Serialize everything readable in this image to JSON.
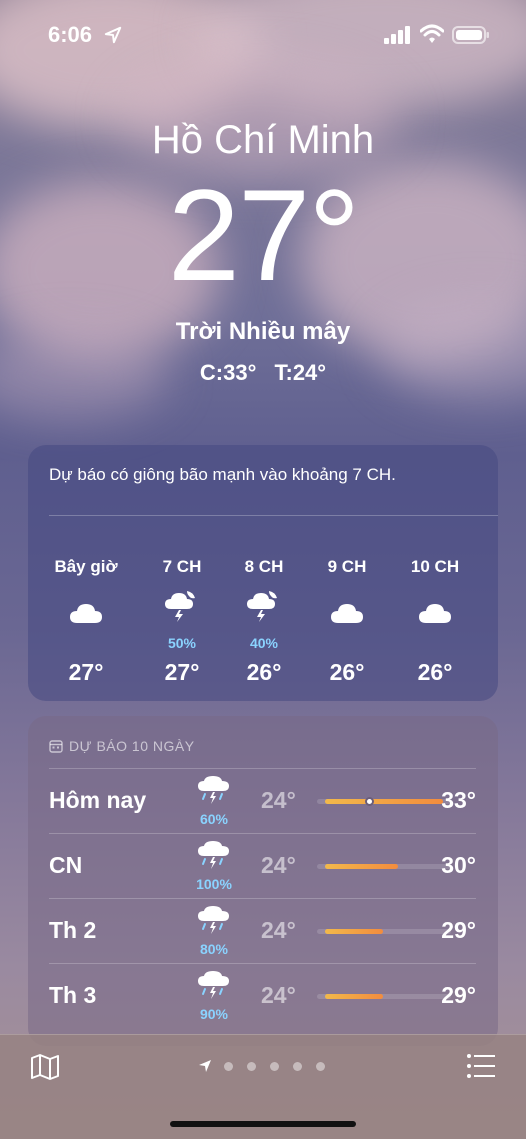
{
  "status_bar": {
    "time": "6:06"
  },
  "header": {
    "city": "Hồ Chí Minh",
    "temperature": "27°",
    "condition": "Trời Nhiều mây",
    "high": "C:33°",
    "low": "T:24°"
  },
  "hourly": {
    "alert": "Dự báo có giông bão mạnh vào khoảng 7 CH.",
    "items": [
      {
        "label": "Bây giờ",
        "icon": "cloud-icon",
        "precip": "",
        "temp": "27°"
      },
      {
        "label": "7 CH",
        "icon": "thunderstorm-moon-icon",
        "precip": "50%",
        "temp": "27°"
      },
      {
        "label": "8 CH",
        "icon": "thunderstorm-moon-icon",
        "precip": "40%",
        "temp": "26°"
      },
      {
        "label": "9 CH",
        "icon": "cloud-icon",
        "precip": "",
        "temp": "26°"
      },
      {
        "label": "10 CH",
        "icon": "cloud-icon",
        "precip": "",
        "temp": "26°"
      }
    ]
  },
  "daily": {
    "header": "DỰ BÁO 10 NGÀY",
    "range_min": 24,
    "range_max": 33,
    "current_temp": 27,
    "rows": [
      {
        "day": "Hôm nay",
        "icon": "thunderstorm-rain-icon",
        "precip": "60%",
        "low": "24°",
        "high": "33°",
        "low_value": 24,
        "high_value": 33,
        "show_current": true
      },
      {
        "day": "CN",
        "icon": "thunderstorm-rain-icon",
        "precip": "100%",
        "low": "24°",
        "high": "30°",
        "low_value": 24,
        "high_value": 30,
        "show_current": false
      },
      {
        "day": "Th 2",
        "icon": "thunderstorm-rain-icon",
        "precip": "80%",
        "low": "24°",
        "high": "29°",
        "low_value": 24,
        "high_value": 29,
        "show_current": false
      },
      {
        "day": "Th 3",
        "icon": "thunderstorm-rain-icon",
        "precip": "90%",
        "low": "24°",
        "high": "29°",
        "low_value": 24,
        "high_value": 29,
        "show_current": false
      }
    ]
  },
  "bottom_bar": {
    "page_count": 5,
    "current_page": 0
  },
  "colors": {
    "precip": "#8ad3ff",
    "bar_start": "#f2b94b",
    "bar_end": "#f28c3e"
  }
}
